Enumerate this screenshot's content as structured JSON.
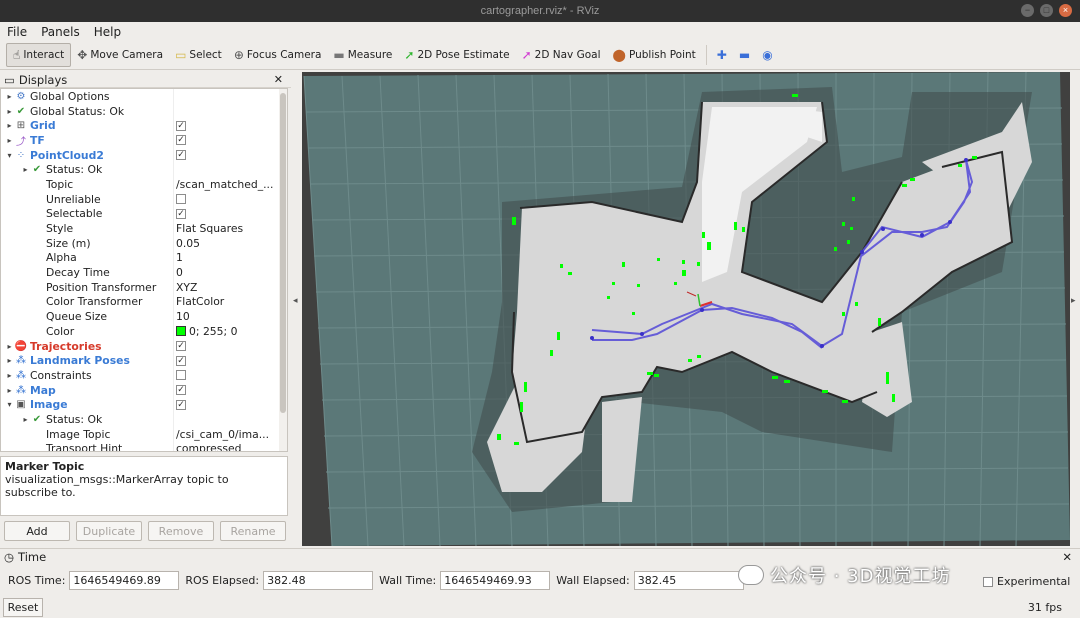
{
  "window": {
    "title": "cartographer.rviz* - RViz",
    "buttons": [
      "−",
      "□",
      "×"
    ]
  },
  "menu": [
    "File",
    "Panels",
    "Help"
  ],
  "toolbar": [
    {
      "label": "Interact",
      "icon": "cursor-icon",
      "glyph": "☝",
      "color": "#333",
      "active": true
    },
    {
      "label": "Move Camera",
      "icon": "move-camera-icon",
      "glyph": "✥",
      "color": "#555"
    },
    {
      "label": "Select",
      "icon": "select-icon",
      "glyph": "▭",
      "color": "#d4b84a"
    },
    {
      "label": "Focus Camera",
      "icon": "focus-camera-icon",
      "glyph": "⊕",
      "color": "#555"
    },
    {
      "label": "Measure",
      "icon": "measure-icon",
      "glyph": "▬",
      "color": "#777"
    },
    {
      "label": "2D Pose Estimate",
      "icon": "pose-estimate-icon",
      "glyph": "➚",
      "color": "#2db52d"
    },
    {
      "label": "2D Nav Goal",
      "icon": "nav-goal-icon",
      "glyph": "➚",
      "color": "#d13cd1"
    },
    {
      "label": "Publish Point",
      "icon": "publish-point-icon",
      "glyph": "⬤",
      "color": "#c0642a"
    }
  ],
  "toolbar_extra": [
    {
      "icon": "plus-icon",
      "glyph": "✚",
      "color": "#3a6fd8"
    },
    {
      "icon": "minus-icon",
      "glyph": "▬",
      "color": "#3a6fd8"
    },
    {
      "icon": "eye-icon",
      "glyph": "◉",
      "color": "#3a6fd8"
    }
  ],
  "displays": {
    "title": "Displays",
    "rows": [
      {
        "indent": 0,
        "arrow": "▸",
        "icon": "⚙",
        "iconColor": "#4a7bc8",
        "name": "Global Options",
        "style": "",
        "value": ""
      },
      {
        "indent": 0,
        "arrow": "▸",
        "icon": "✔",
        "iconColor": "#3a9a3a",
        "name": "Global Status: Ok",
        "style": "",
        "value": ""
      },
      {
        "indent": 0,
        "arrow": "▸",
        "icon": "⊞",
        "iconColor": "#555",
        "name": "Grid",
        "style": "blue",
        "check": true
      },
      {
        "indent": 0,
        "arrow": "▸",
        "icon": "⤴",
        "iconColor": "#9a5ac8",
        "name": "TF",
        "style": "blue",
        "check": true
      },
      {
        "indent": 0,
        "arrow": "▾",
        "icon": "⁘",
        "iconColor": "#4a7bc8",
        "name": "PointCloud2",
        "style": "blue",
        "check": true
      },
      {
        "indent": 1,
        "arrow": "▸",
        "icon": "✔",
        "iconColor": "#3a9a3a",
        "name": "Status: Ok",
        "style": "",
        "value": ""
      },
      {
        "indent": 1,
        "arrow": "",
        "icon": "",
        "name": "Topic",
        "style": "",
        "value": "/scan_matched_..."
      },
      {
        "indent": 1,
        "arrow": "",
        "icon": "",
        "name": "Unreliable",
        "style": "",
        "check": false
      },
      {
        "indent": 1,
        "arrow": "",
        "icon": "",
        "name": "Selectable",
        "style": "",
        "check": true
      },
      {
        "indent": 1,
        "arrow": "",
        "icon": "",
        "name": "Style",
        "style": "",
        "value": "Flat Squares"
      },
      {
        "indent": 1,
        "arrow": "",
        "icon": "",
        "name": "Size (m)",
        "style": "",
        "value": "0.05"
      },
      {
        "indent": 1,
        "arrow": "",
        "icon": "",
        "name": "Alpha",
        "style": "",
        "value": "1"
      },
      {
        "indent": 1,
        "arrow": "",
        "icon": "",
        "name": "Decay Time",
        "style": "",
        "value": "0"
      },
      {
        "indent": 1,
        "arrow": "",
        "icon": "",
        "name": "Position Transformer",
        "style": "",
        "value": "XYZ"
      },
      {
        "indent": 1,
        "arrow": "",
        "icon": "",
        "name": "Color Transformer",
        "style": "",
        "value": "FlatColor"
      },
      {
        "indent": 1,
        "arrow": "",
        "icon": "",
        "name": "Queue Size",
        "style": "",
        "value": "10"
      },
      {
        "indent": 1,
        "arrow": "",
        "icon": "",
        "name": "Color",
        "style": "",
        "value": "0; 255; 0",
        "swatch": "#00ff00"
      },
      {
        "indent": 0,
        "arrow": "▸",
        "icon": "⛔",
        "iconColor": "#d62a2a",
        "name": "Trajectories",
        "style": "red",
        "check": true
      },
      {
        "indent": 0,
        "arrow": "▸",
        "icon": "⁂",
        "iconColor": "#2f6fd0",
        "name": "Landmark Poses",
        "style": "blue",
        "check": true
      },
      {
        "indent": 0,
        "arrow": "▸",
        "icon": "⁂",
        "iconColor": "#2f6fd0",
        "name": "Constraints",
        "style": "",
        "check": false
      },
      {
        "indent": 0,
        "arrow": "▸",
        "icon": "⁂",
        "iconColor": "#2f6fd0",
        "name": "Map",
        "style": "blue",
        "check": true
      },
      {
        "indent": 0,
        "arrow": "▾",
        "icon": "▣",
        "iconColor": "#555",
        "name": "Image",
        "style": "blue",
        "check": true
      },
      {
        "indent": 1,
        "arrow": "▸",
        "icon": "✔",
        "iconColor": "#3a9a3a",
        "name": "Status: Ok",
        "style": "",
        "value": ""
      },
      {
        "indent": 1,
        "arrow": "",
        "icon": "",
        "name": "Image Topic",
        "style": "",
        "value": "/csi_cam_0/ima..."
      },
      {
        "indent": 1,
        "arrow": "",
        "icon": "",
        "name": "Transport Hint",
        "style": "",
        "value": "compressed"
      }
    ],
    "desc_title": "Marker Topic",
    "desc_body": "visualization_msgs::MarkerArray topic to subscribe to.",
    "buttons": [
      {
        "label": "Add",
        "enabled": true
      },
      {
        "label": "Duplicate",
        "enabled": false
      },
      {
        "label": "Remove",
        "enabled": false
      },
      {
        "label": "Rename",
        "enabled": false
      }
    ]
  },
  "time": {
    "title": "Time",
    "ros_time_label": "ROS Time:",
    "ros_time": "1646549469.89",
    "ros_elapsed_label": "ROS Elapsed:",
    "ros_elapsed": "382.48",
    "wall_time_label": "Wall Time:",
    "wall_time": "1646549469.93",
    "wall_elapsed_label": "Wall Elapsed:",
    "wall_elapsed": "382.45",
    "experimental_label": "Experimental",
    "reset_label": "Reset",
    "fps": "31 fps"
  },
  "watermark": "公众号 · 3D视觉工坊",
  "colors": {
    "grid_bg": "#5b7878",
    "outer_bg": "#444444",
    "free": "#d6d6d6",
    "wall": "#2a2a2a",
    "pointcloud": "#00ff00",
    "trajectory": "#5a50d8"
  }
}
